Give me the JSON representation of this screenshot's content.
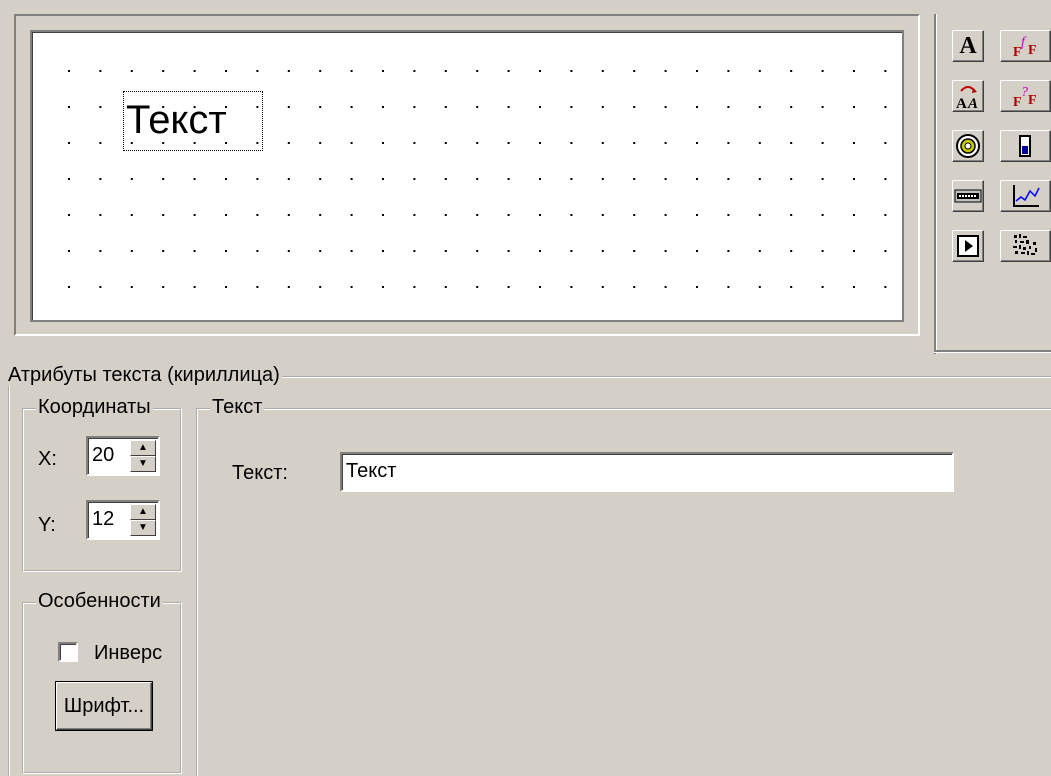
{
  "canvas": {
    "text": "Текст"
  },
  "toolbar": {
    "buttons": [
      {
        "name": "text-tool-icon"
      },
      {
        "name": "font-field-icon"
      },
      {
        "name": "cyrillic-text-icon"
      },
      {
        "name": "font-variable-icon"
      },
      {
        "name": "indicator-lamp-icon"
      },
      {
        "name": "bar-gauge-icon"
      },
      {
        "name": "number-display-icon"
      },
      {
        "name": "trend-chart-icon"
      },
      {
        "name": "play-button-icon"
      },
      {
        "name": "bitmap-icon"
      }
    ]
  },
  "attributes": {
    "title": "Атрибуты текста (кириллица)",
    "coords": {
      "title": "Координаты",
      "x_label": "X:",
      "x_value": "20",
      "y_label": "Y:",
      "y_value": "12"
    },
    "features": {
      "title": "Особенности",
      "inverse_label": "Инверс",
      "inverse_checked": false,
      "font_button": "Шрифт..."
    },
    "text_group": {
      "title": "Текст",
      "text_label": "Текст:",
      "text_value": "Текст"
    }
  },
  "colors": {
    "face": "#d4d0c8",
    "shadow": "#808080",
    "highlight": "#ffffff",
    "canvas": "#ffffff"
  }
}
